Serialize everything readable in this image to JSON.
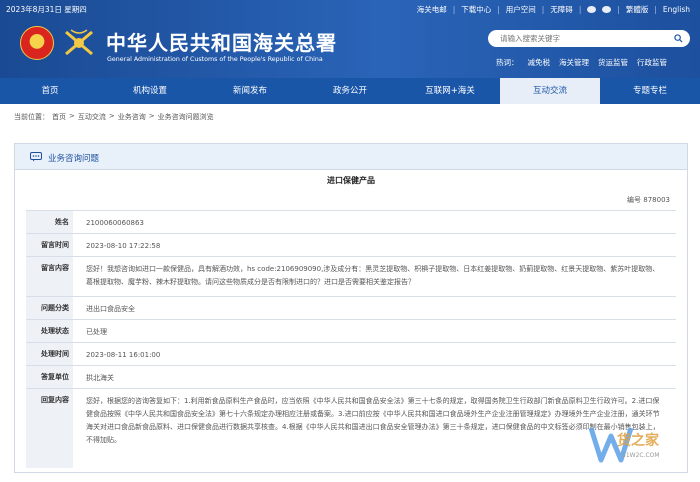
{
  "topbar": {
    "date": "2023年8月31日 星期四",
    "links": [
      "海关电邮",
      "|",
      "下载中心",
      "|",
      "用户空间",
      "|",
      "无障碍",
      "|",
      "",
      "",
      "|",
      "繁體版",
      "|",
      "English"
    ]
  },
  "site": {
    "title_cn": "中华人民共和国海关总署",
    "title_en": "General Administration of Customs of the People's Republic of China"
  },
  "search": {
    "placeholder": "请输入搜索关键字"
  },
  "hot": {
    "label": "热词：",
    "items": [
      "减免税",
      "海关管理",
      "货运监管",
      "行政监管"
    ]
  },
  "nav": [
    "首页",
    "机构设置",
    "新闻发布",
    "政务公开",
    "互联网+海关",
    "互动交流",
    "专题专栏"
  ],
  "breadcrumb": [
    "当前位置：",
    "首页",
    ">",
    "互动交流",
    ">",
    "业务咨询",
    ">",
    "业务咨询问题浏览"
  ],
  "panel": {
    "title": "业务咨询问题"
  },
  "doc": {
    "title": "进口保健产品",
    "code_label": "编号",
    "code": "878003",
    "rows": [
      {
        "label": "姓名",
        "value": "2100060060863"
      },
      {
        "label": "留言时间",
        "value": "2023-08-10 17:22:58"
      },
      {
        "label": "留言内容",
        "value": "您好！我想咨询如进口一款保健品，具有解酒功效，hs code:2106909090,涉及成分有：黑灵芝提取物、枳椇子提取物、日本红姜提取物、奶蓟提取物、红景天提取物、紫苏叶提取物、葛根提取物、魔芋粉、辣木籽提取物。请问这些物质成分是否有限制进口的？进口是否需要相关鉴定报告？"
      },
      {
        "label": "问题分类",
        "value": "进出口食品安全"
      },
      {
        "label": "处理状态",
        "value": "已处理"
      },
      {
        "label": "处理时间",
        "value": "2023-08-11 16:01:00"
      },
      {
        "label": "答复单位",
        "value": "拱北海关"
      },
      {
        "label": "回复内容",
        "value": "您好，根据您的咨询答复如下：1.利用新食品原料生产食品时，应当依照《中华人民共和国食品安全法》第三十七条的规定，取得国务院卫生行政部门新食品原料卫生行政许可。2.进口保健食品按照《中华人民共和国食品安全法》第七十六条规定办理相应注册或备案。3.进口前应按《中华人民共和国进口食品境外生产企业注册管理规定》办理境外生产企业注册，通关环节海关对进口食品新食品原料、进口保健食品进行数据共享核查。4.根据《中华人民共和国进出口食品安全管理办法》第三十条规定，进口保健食品的中文标签必须印制在最小销售包装上，不得加贴。"
      }
    ]
  },
  "watermark": {
    "text": "货之家",
    "url": "51W2C.COM"
  }
}
